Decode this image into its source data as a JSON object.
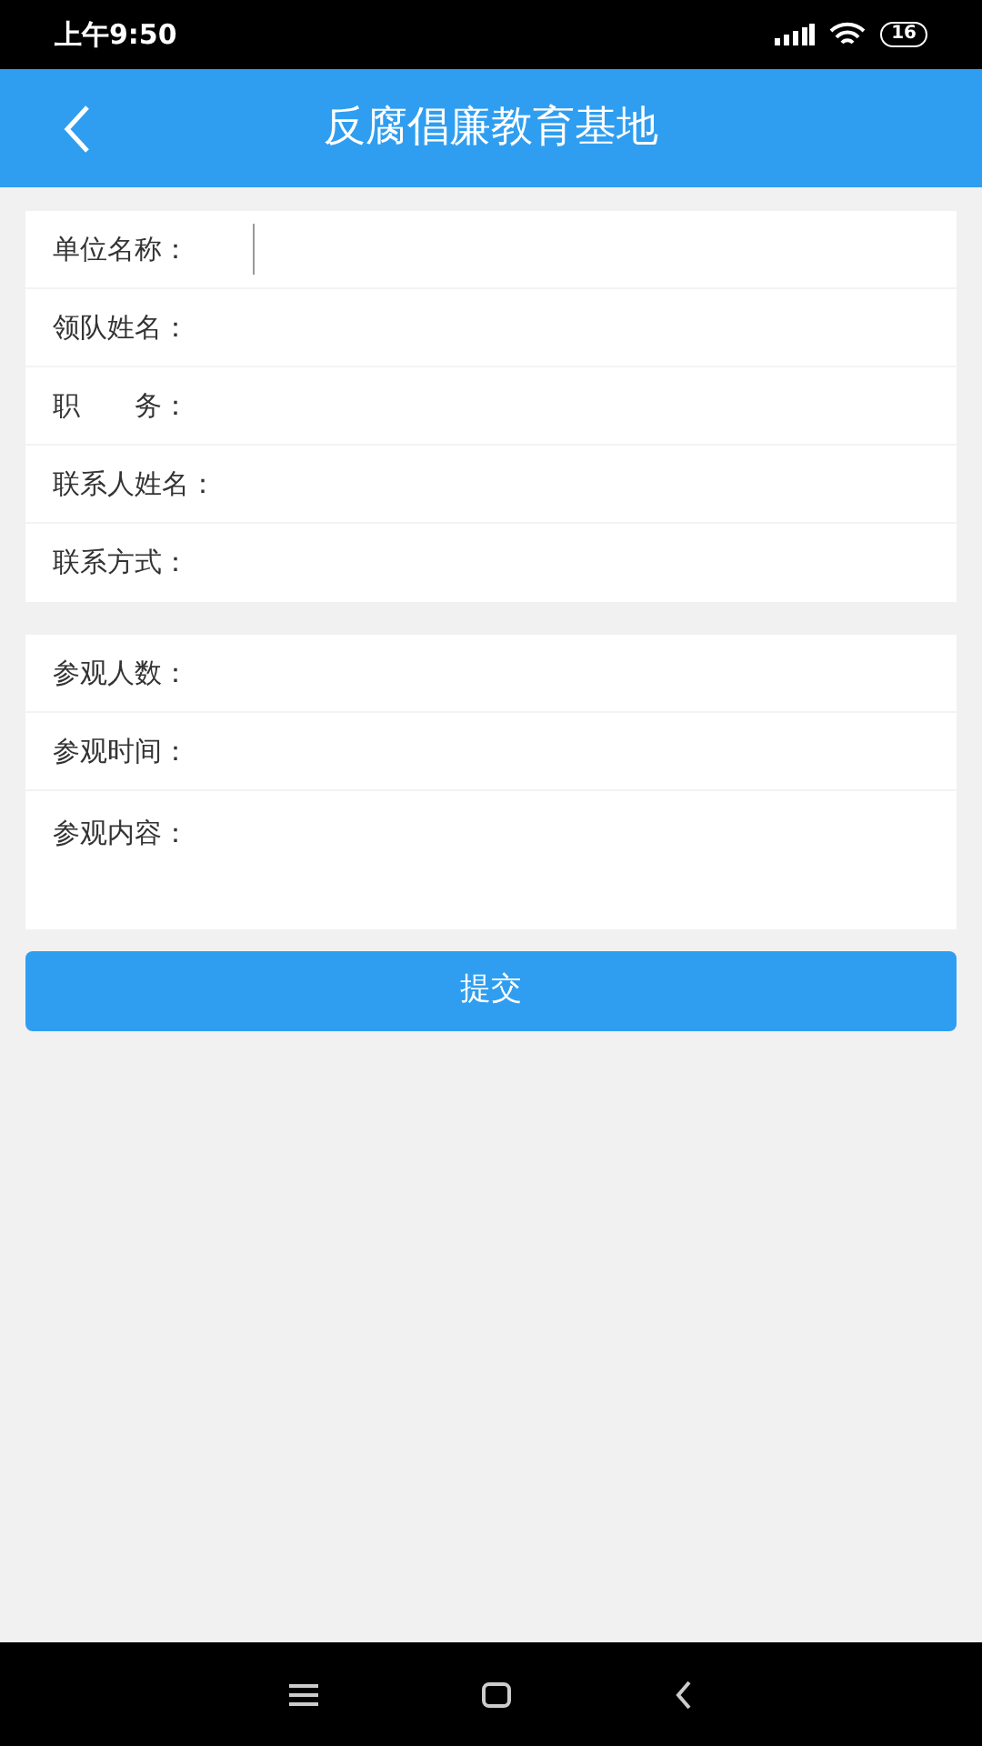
{
  "status_bar": {
    "time": "上午9:50",
    "battery": "16"
  },
  "header": {
    "title": "反腐倡廉教育基地"
  },
  "sections": [
    {
      "fields": [
        {
          "label": "单位名称：",
          "kind": "input",
          "focused": true
        },
        {
          "label": "领队姓名：",
          "kind": "input",
          "focused": false
        },
        {
          "label": "职　　务：",
          "kind": "input",
          "focused": false
        },
        {
          "label": "联系人姓名：",
          "kind": "input",
          "focused": false
        },
        {
          "label": "联系方式：",
          "kind": "input",
          "focused": false
        }
      ]
    },
    {
      "fields": [
        {
          "label": "参观人数：",
          "kind": "input",
          "focused": false
        },
        {
          "label": "参观时间：",
          "kind": "input",
          "focused": false
        },
        {
          "label": "参观内容：",
          "kind": "textarea",
          "focused": false
        }
      ]
    }
  ],
  "submit": {
    "label": "提交"
  }
}
